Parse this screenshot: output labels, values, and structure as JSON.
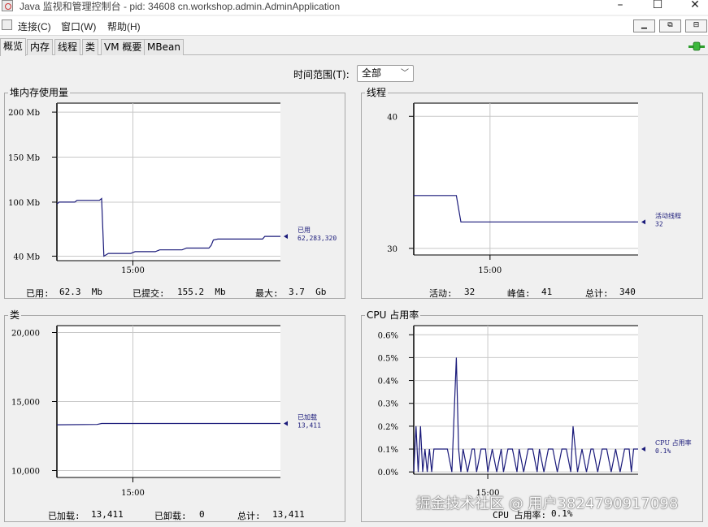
{
  "window": {
    "title": "Java 监视和管理控制台 - pid: 34608 cn.workshop.admin.AdminApplication",
    "minimize_glyph": "–",
    "maximize_glyph": "☐",
    "close_glyph": "✕"
  },
  "menu": {
    "items": [
      "连接(C)",
      "窗口(W)",
      "帮助(H)"
    ],
    "mdi_buttons": [
      "▁",
      "⧉",
      "⊟"
    ]
  },
  "tabs": [
    "概览",
    "内存",
    "线程",
    "类",
    "VM 概要",
    "MBean"
  ],
  "active_tab": 0,
  "time_range": {
    "label": "时间范围(T):",
    "selected": "全部"
  },
  "panels": {
    "heap": {
      "title": "堆内存使用量",
      "stats": [
        {
          "label": "已用:",
          "value": "62.3  Mb"
        },
        {
          "label": "已提交:",
          "value": "155.2  Mb"
        },
        {
          "label": "最大:",
          "value": "3.7  Gb"
        }
      ]
    },
    "threads": {
      "title": "线程",
      "stats": [
        {
          "label": "活动:",
          "value": "32"
        },
        {
          "label": "峰值:",
          "value": "41"
        },
        {
          "label": "总计:",
          "value": "340"
        }
      ]
    },
    "classes": {
      "title": "类",
      "stats": [
        {
          "label": "已加载:",
          "value": "13,411"
        },
        {
          "label": "已卸载:",
          "value": "0"
        },
        {
          "label": "总计:",
          "value": "13,411"
        }
      ]
    },
    "cpu": {
      "title": "CPU 占用率",
      "stats": [
        {
          "label": "CPU 占用率:",
          "value": "0.1%"
        }
      ]
    }
  },
  "chart_data": [
    {
      "type": "line",
      "y_ticks": [
        "200 Mb",
        "150 Mb",
        "100 Mb",
        "40 Mb"
      ],
      "y_tick_values": [
        200,
        150,
        100,
        40
      ],
      "ylim": [
        35,
        210
      ],
      "x_ticks": [
        "15:00"
      ],
      "xlim": [
        0,
        100
      ],
      "x_tick_values": [
        34
      ],
      "series": [
        {
          "name": "已用",
          "label_value": "62,283,320",
          "color": "#1a1a7a",
          "x": [
            0,
            1,
            8,
            9,
            19,
            20,
            21,
            23,
            33,
            35,
            44,
            46,
            56,
            58,
            68,
            69,
            70,
            72,
            92,
            93,
            100
          ],
          "y": [
            98,
            100,
            100,
            102,
            102,
            104,
            40,
            43,
            43,
            45,
            45,
            47,
            47,
            49,
            49,
            52,
            58,
            59,
            59,
            62,
            62
          ]
        }
      ],
      "grid": true,
      "legend_position": "right"
    },
    {
      "type": "line",
      "y_ticks": [
        "40",
        "30"
      ],
      "y_tick_values": [
        40,
        30
      ],
      "ylim": [
        29.5,
        41
      ],
      "x_ticks": [
        "15:00"
      ],
      "xlim": [
        0,
        100
      ],
      "x_tick_values": [
        34
      ],
      "series": [
        {
          "name": "活动线程",
          "label_value": "32",
          "color": "#1a1a7a",
          "x": [
            0,
            19,
            21,
            100
          ],
          "y": [
            34,
            34,
            32,
            32
          ]
        }
      ],
      "grid": true,
      "legend_position": "right"
    },
    {
      "type": "line",
      "y_ticks": [
        "20,000",
        "15,000",
        "10,000"
      ],
      "y_tick_values": [
        20000,
        15000,
        10000
      ],
      "ylim": [
        9500,
        20500
      ],
      "x_ticks": [
        "15:00"
      ],
      "xlim": [
        0,
        100
      ],
      "x_tick_values": [
        34
      ],
      "series": [
        {
          "name": "已加载",
          "label_value": "13,411",
          "color": "#1a1a7a",
          "x": [
            0,
            18,
            20,
            100
          ],
          "y": [
            13320,
            13340,
            13411,
            13411
          ]
        }
      ],
      "grid": true,
      "legend_position": "right"
    },
    {
      "type": "line",
      "y_ticks": [
        "0.6%",
        "0.5%",
        "0.4%",
        "0.3%",
        "0.2%",
        "0.1%",
        "0.0%"
      ],
      "y_tick_values": [
        0.6,
        0.5,
        0.4,
        0.3,
        0.2,
        0.1,
        0.0
      ],
      "ylim": [
        -0.01,
        0.64
      ],
      "x_ticks": [
        "15:00"
      ],
      "xlim": [
        0,
        100
      ],
      "x_tick_values": [
        33
      ],
      "series": [
        {
          "name": "CPU 占用率",
          "label_value": "0.1%",
          "color": "#1a1a7a",
          "x": [
            0,
            1,
            2,
            3,
            4,
            5,
            6,
            7,
            8,
            9,
            12,
            15,
            17,
            19,
            20,
            21,
            22,
            24,
            26,
            27,
            28,
            30,
            32,
            33,
            35,
            37,
            39,
            40,
            42,
            44,
            46,
            47,
            49,
            51,
            53,
            55,
            56,
            58,
            60,
            62,
            64,
            66,
            68,
            70,
            71,
            73,
            75,
            77,
            79,
            80,
            82,
            84,
            86,
            88,
            90,
            92,
            94,
            96,
            97,
            98,
            100
          ],
          "y": [
            0.0,
            0.2,
            0.0,
            0.2,
            0.0,
            0.1,
            0.0,
            0.1,
            0.0,
            0.1,
            0.1,
            0.1,
            0.0,
            0.5,
            0.1,
            0.0,
            0.1,
            0.0,
            0.1,
            0.1,
            0.0,
            0.1,
            0.1,
            0.0,
            0.1,
            0.0,
            0.1,
            0.0,
            0.1,
            0.1,
            0.0,
            0.1,
            0.0,
            0.1,
            0.1,
            0.0,
            0.1,
            0.0,
            0.1,
            0.1,
            0.0,
            0.1,
            0.1,
            0.0,
            0.2,
            0.0,
            0.1,
            0.0,
            0.1,
            0.1,
            0.0,
            0.1,
            0.1,
            0.0,
            0.1,
            0.0,
            0.1,
            0.1,
            0.0,
            0.1,
            0.1
          ]
        }
      ],
      "grid": true,
      "legend_position": "right"
    }
  ],
  "watermark": "掘金技术社区 @ 用户3824790917098"
}
